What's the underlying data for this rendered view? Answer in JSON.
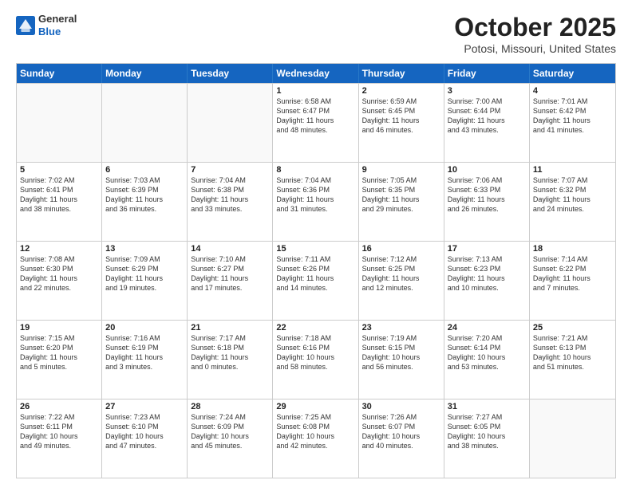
{
  "header": {
    "logo": {
      "general": "General",
      "blue": "Blue"
    },
    "title": "October 2025",
    "location": "Potosi, Missouri, United States"
  },
  "days_of_week": [
    "Sunday",
    "Monday",
    "Tuesday",
    "Wednesday",
    "Thursday",
    "Friday",
    "Saturday"
  ],
  "weeks": [
    [
      {
        "day": "",
        "content": ""
      },
      {
        "day": "",
        "content": ""
      },
      {
        "day": "",
        "content": ""
      },
      {
        "day": "1",
        "content": "Sunrise: 6:58 AM\nSunset: 6:47 PM\nDaylight: 11 hours\nand 48 minutes."
      },
      {
        "day": "2",
        "content": "Sunrise: 6:59 AM\nSunset: 6:45 PM\nDaylight: 11 hours\nand 46 minutes."
      },
      {
        "day": "3",
        "content": "Sunrise: 7:00 AM\nSunset: 6:44 PM\nDaylight: 11 hours\nand 43 minutes."
      },
      {
        "day": "4",
        "content": "Sunrise: 7:01 AM\nSunset: 6:42 PM\nDaylight: 11 hours\nand 41 minutes."
      }
    ],
    [
      {
        "day": "5",
        "content": "Sunrise: 7:02 AM\nSunset: 6:41 PM\nDaylight: 11 hours\nand 38 minutes."
      },
      {
        "day": "6",
        "content": "Sunrise: 7:03 AM\nSunset: 6:39 PM\nDaylight: 11 hours\nand 36 minutes."
      },
      {
        "day": "7",
        "content": "Sunrise: 7:04 AM\nSunset: 6:38 PM\nDaylight: 11 hours\nand 33 minutes."
      },
      {
        "day": "8",
        "content": "Sunrise: 7:04 AM\nSunset: 6:36 PM\nDaylight: 11 hours\nand 31 minutes."
      },
      {
        "day": "9",
        "content": "Sunrise: 7:05 AM\nSunset: 6:35 PM\nDaylight: 11 hours\nand 29 minutes."
      },
      {
        "day": "10",
        "content": "Sunrise: 7:06 AM\nSunset: 6:33 PM\nDaylight: 11 hours\nand 26 minutes."
      },
      {
        "day": "11",
        "content": "Sunrise: 7:07 AM\nSunset: 6:32 PM\nDaylight: 11 hours\nand 24 minutes."
      }
    ],
    [
      {
        "day": "12",
        "content": "Sunrise: 7:08 AM\nSunset: 6:30 PM\nDaylight: 11 hours\nand 22 minutes."
      },
      {
        "day": "13",
        "content": "Sunrise: 7:09 AM\nSunset: 6:29 PM\nDaylight: 11 hours\nand 19 minutes."
      },
      {
        "day": "14",
        "content": "Sunrise: 7:10 AM\nSunset: 6:27 PM\nDaylight: 11 hours\nand 17 minutes."
      },
      {
        "day": "15",
        "content": "Sunrise: 7:11 AM\nSunset: 6:26 PM\nDaylight: 11 hours\nand 14 minutes."
      },
      {
        "day": "16",
        "content": "Sunrise: 7:12 AM\nSunset: 6:25 PM\nDaylight: 11 hours\nand 12 minutes."
      },
      {
        "day": "17",
        "content": "Sunrise: 7:13 AM\nSunset: 6:23 PM\nDaylight: 11 hours\nand 10 minutes."
      },
      {
        "day": "18",
        "content": "Sunrise: 7:14 AM\nSunset: 6:22 PM\nDaylight: 11 hours\nand 7 minutes."
      }
    ],
    [
      {
        "day": "19",
        "content": "Sunrise: 7:15 AM\nSunset: 6:20 PM\nDaylight: 11 hours\nand 5 minutes."
      },
      {
        "day": "20",
        "content": "Sunrise: 7:16 AM\nSunset: 6:19 PM\nDaylight: 11 hours\nand 3 minutes."
      },
      {
        "day": "21",
        "content": "Sunrise: 7:17 AM\nSunset: 6:18 PM\nDaylight: 11 hours\nand 0 minutes."
      },
      {
        "day": "22",
        "content": "Sunrise: 7:18 AM\nSunset: 6:16 PM\nDaylight: 10 hours\nand 58 minutes."
      },
      {
        "day": "23",
        "content": "Sunrise: 7:19 AM\nSunset: 6:15 PM\nDaylight: 10 hours\nand 56 minutes."
      },
      {
        "day": "24",
        "content": "Sunrise: 7:20 AM\nSunset: 6:14 PM\nDaylight: 10 hours\nand 53 minutes."
      },
      {
        "day": "25",
        "content": "Sunrise: 7:21 AM\nSunset: 6:13 PM\nDaylight: 10 hours\nand 51 minutes."
      }
    ],
    [
      {
        "day": "26",
        "content": "Sunrise: 7:22 AM\nSunset: 6:11 PM\nDaylight: 10 hours\nand 49 minutes."
      },
      {
        "day": "27",
        "content": "Sunrise: 7:23 AM\nSunset: 6:10 PM\nDaylight: 10 hours\nand 47 minutes."
      },
      {
        "day": "28",
        "content": "Sunrise: 7:24 AM\nSunset: 6:09 PM\nDaylight: 10 hours\nand 45 minutes."
      },
      {
        "day": "29",
        "content": "Sunrise: 7:25 AM\nSunset: 6:08 PM\nDaylight: 10 hours\nand 42 minutes."
      },
      {
        "day": "30",
        "content": "Sunrise: 7:26 AM\nSunset: 6:07 PM\nDaylight: 10 hours\nand 40 minutes."
      },
      {
        "day": "31",
        "content": "Sunrise: 7:27 AM\nSunset: 6:05 PM\nDaylight: 10 hours\nand 38 minutes."
      },
      {
        "day": "",
        "content": ""
      }
    ]
  ]
}
